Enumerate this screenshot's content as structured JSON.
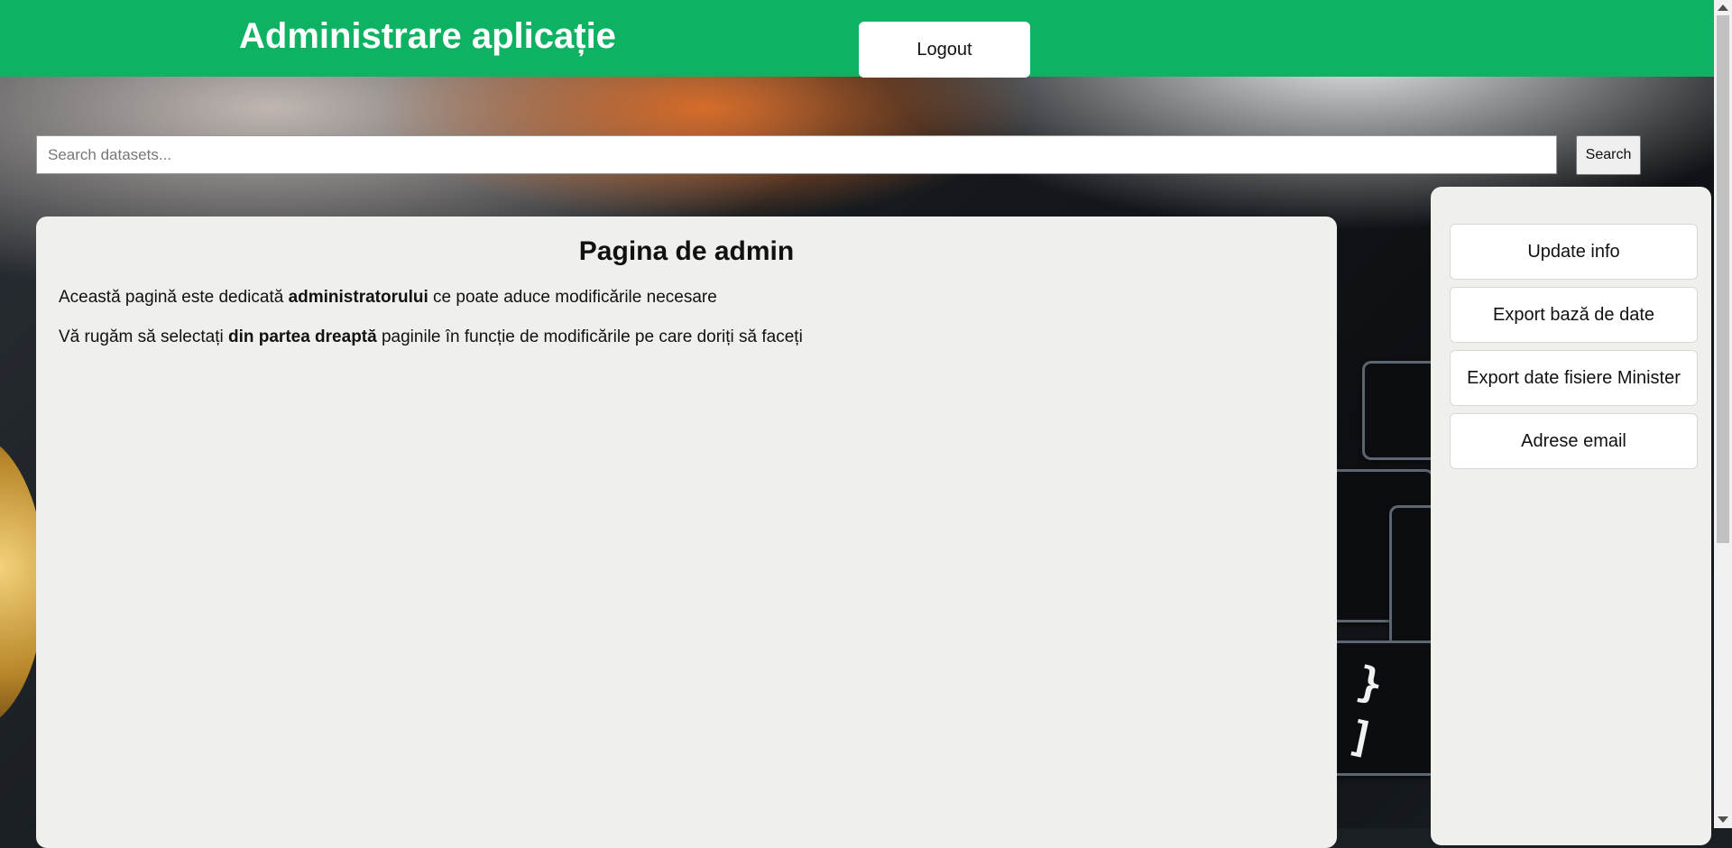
{
  "header": {
    "title": "Administrare aplicație",
    "logout_label": "Logout",
    "color": "#0fb263"
  },
  "search": {
    "placeholder": "Search datasets...",
    "value": "",
    "button_label": "Search"
  },
  "main": {
    "title": "Pagina de admin",
    "paragraph1": {
      "before": "Această pagină este dedicată ",
      "bold": "administratorului",
      "after": " ce poate aduce modificările necesare"
    },
    "paragraph2": {
      "before": "Vă rugăm să selectați ",
      "bold": "din partea dreaptă",
      "after": " paginile în funcție de modificările pe care doriți să faceți"
    }
  },
  "sidebar": {
    "items": [
      {
        "label": "Update info"
      },
      {
        "label": "Export bază de date"
      },
      {
        "label": "Export date fisiere Minister"
      },
      {
        "label": "Adrese email"
      }
    ]
  }
}
